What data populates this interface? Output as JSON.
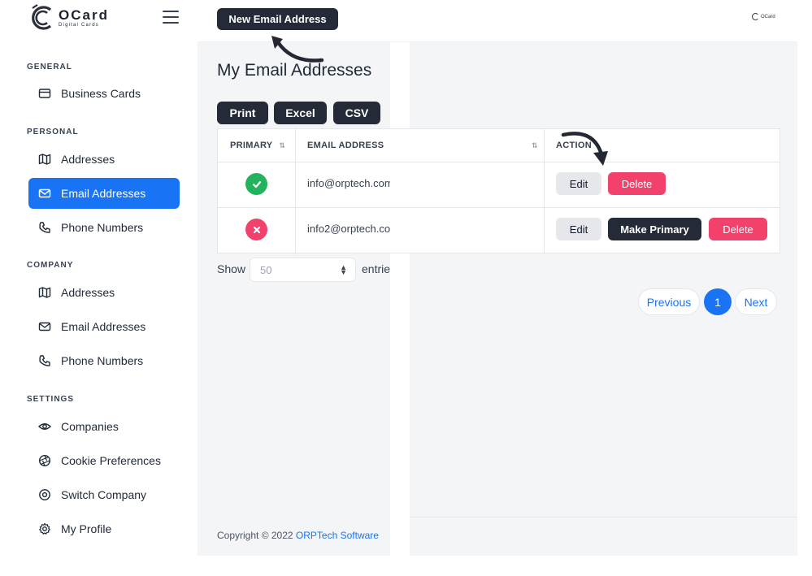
{
  "app": {
    "logo_title": "OCard",
    "logo_subtitle": "Digital Cards",
    "top_logo_text": "OCard"
  },
  "sidebar": {
    "sections": [
      {
        "title": "GENERAL",
        "items": [
          {
            "label": "Business Cards",
            "icon": "card-icon"
          }
        ]
      },
      {
        "title": "PERSONAL",
        "items": [
          {
            "label": "Addresses",
            "icon": "map-icon"
          },
          {
            "label": "Email Addresses",
            "icon": "envelope-icon",
            "active": true
          },
          {
            "label": "Phone Numbers",
            "icon": "phone-icon"
          }
        ]
      },
      {
        "title": "COMPANY",
        "items": [
          {
            "label": "Addresses",
            "icon": "map-icon"
          },
          {
            "label": "Email Addresses",
            "icon": "envelope-icon"
          },
          {
            "label": "Phone Numbers",
            "icon": "phone-icon"
          }
        ]
      },
      {
        "title": "SETTINGS",
        "items": [
          {
            "label": "Companies",
            "icon": "eye-icon"
          },
          {
            "label": "Cookie Preferences",
            "icon": "aperture-icon"
          },
          {
            "label": "Switch Company",
            "icon": "target-icon"
          },
          {
            "label": "My Profile",
            "icon": "gear-icon"
          }
        ]
      }
    ]
  },
  "toolbar": {
    "new_button": "New Email Address"
  },
  "page": {
    "title": "My Email Addresses"
  },
  "export_buttons": [
    "Print",
    "Excel",
    "CSV"
  ],
  "table": {
    "columns": [
      "PRIMARY",
      "EMAIL ADDRESS",
      "ACTION"
    ],
    "rows": [
      {
        "primary": true,
        "email": "info@orptech.com",
        "actions": [
          "Edit",
          "Delete"
        ]
      },
      {
        "primary": false,
        "email": "info2@orptech.co",
        "actions": [
          "Edit",
          "Make Primary",
          "Delete"
        ]
      }
    ]
  },
  "length_control": {
    "show_label": "Show",
    "value": "50",
    "suffix_label": "entrie"
  },
  "pagination": {
    "previous": "Previous",
    "current": "1",
    "next": "Next"
  },
  "footer": {
    "copyright": "Copyright © 2022 ",
    "company_link": "ORPTech Software"
  },
  "colors": {
    "accent": "#1874f5",
    "dark_button": "#242a37",
    "danger": "#f2416b",
    "success": "#22b35e"
  }
}
